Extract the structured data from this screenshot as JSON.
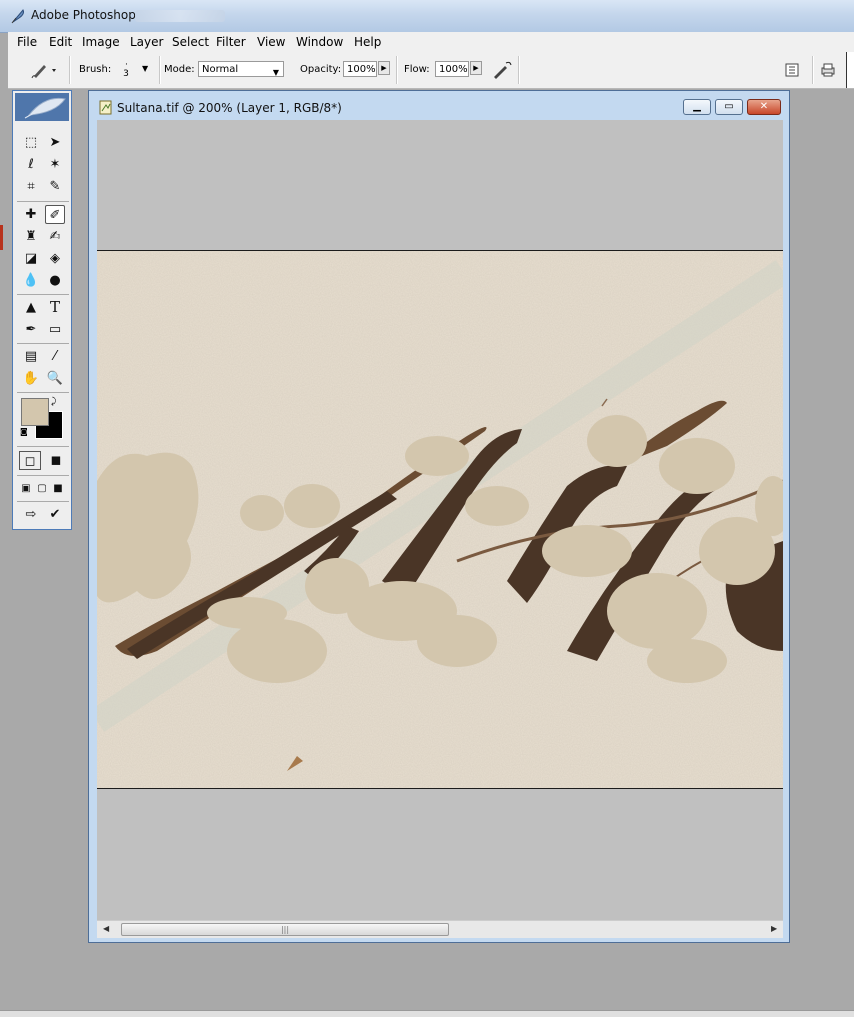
{
  "app": {
    "title": "Adobe Photoshop"
  },
  "menubar": {
    "items": [
      "File",
      "Edit",
      "Image",
      "Layer",
      "Select",
      "Filter",
      "View",
      "Window",
      "Help"
    ]
  },
  "options": {
    "brush_label": "Brush:",
    "brush_size": "3",
    "mode_label": "Mode:",
    "mode_value": "Normal",
    "opacity_label": "Opacity:",
    "opacity_value": "100%",
    "flow_label": "Flow:",
    "flow_value": "100%"
  },
  "document": {
    "title": "Sultana.tif @ 200% (Layer 1, RGB/8*)",
    "zoom_percent": 200
  },
  "tools": {
    "foreground_color": "#d3c6ad",
    "background_color": "#000000",
    "active_tool": "brush-tool",
    "type_glyph": "T"
  },
  "colors": {
    "paper": "#e8dfd0",
    "ink": "#4a3526",
    "paint": "#d3c6ad",
    "canvas_gray": "#c0c0c0"
  }
}
